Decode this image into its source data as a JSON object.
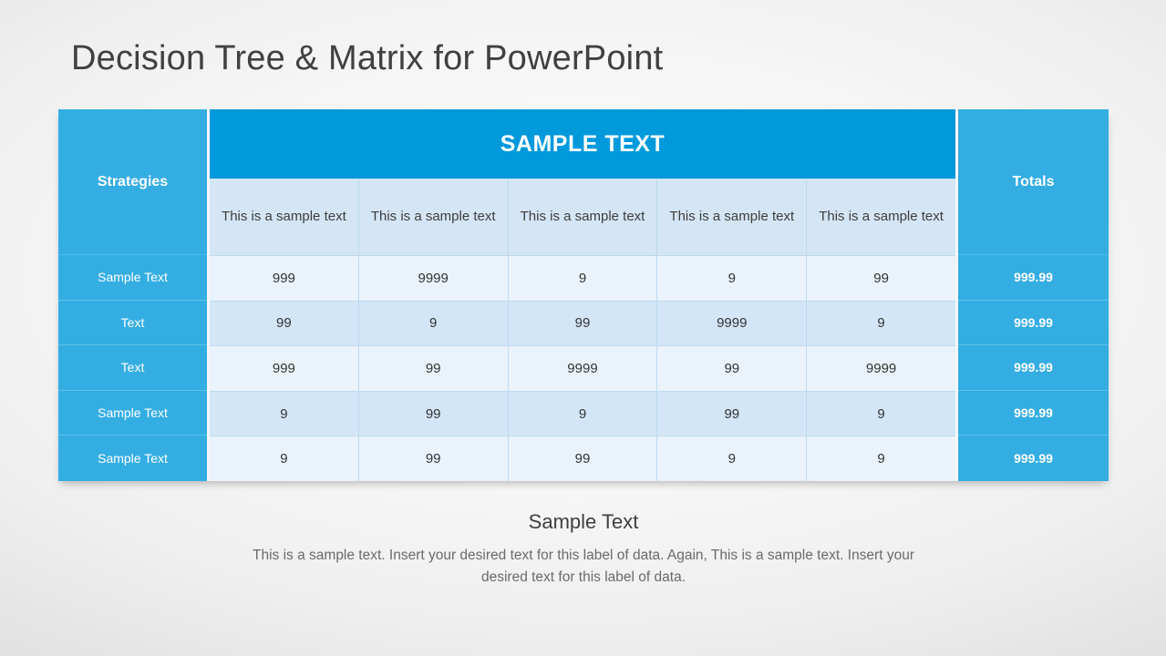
{
  "slide": {
    "title": "Decision Tree & Matrix for PowerPoint"
  },
  "colors": {
    "banner_blue": "#0099DC",
    "column_blue": "#34ADE3",
    "row_light": "#EAF3FB",
    "row_dark": "#D2E6F7",
    "subheader_blue": "#D4E6F5",
    "title_text": "#404040",
    "caption_text": "#6A6A6A"
  },
  "matrix": {
    "banner_title": "SAMPLE TEXT",
    "strategies_header": "Strategies",
    "totals_header": "Totals",
    "column_headers": [
      "This is a sample text",
      "This is a sample text",
      "This is a sample text",
      "This is a sample text",
      "This is a sample text"
    ],
    "rows": [
      {
        "label": "Sample  Text",
        "values": [
          "999",
          "9999",
          "9",
          "9",
          "99"
        ],
        "total": "999.99"
      },
      {
        "label": "Text",
        "values": [
          "99",
          "9",
          "99",
          "9999",
          "9"
        ],
        "total": "999.99"
      },
      {
        "label": "Text",
        "values": [
          "999",
          "99",
          "9999",
          "99",
          "9999"
        ],
        "total": "999.99"
      },
      {
        "label": "Sample  Text",
        "values": [
          "9",
          "99",
          "9",
          "99",
          "9"
        ],
        "total": "999.99"
      },
      {
        "label": "Sample  Text",
        "values": [
          "9",
          "99",
          "99",
          "9",
          "9"
        ],
        "total": "999.99"
      }
    ]
  },
  "caption": {
    "title": "Sample Text",
    "body": "This is a sample text. Insert your desired text for this label of data. Again, This is a sample text. Insert your desired text for this label of data."
  }
}
